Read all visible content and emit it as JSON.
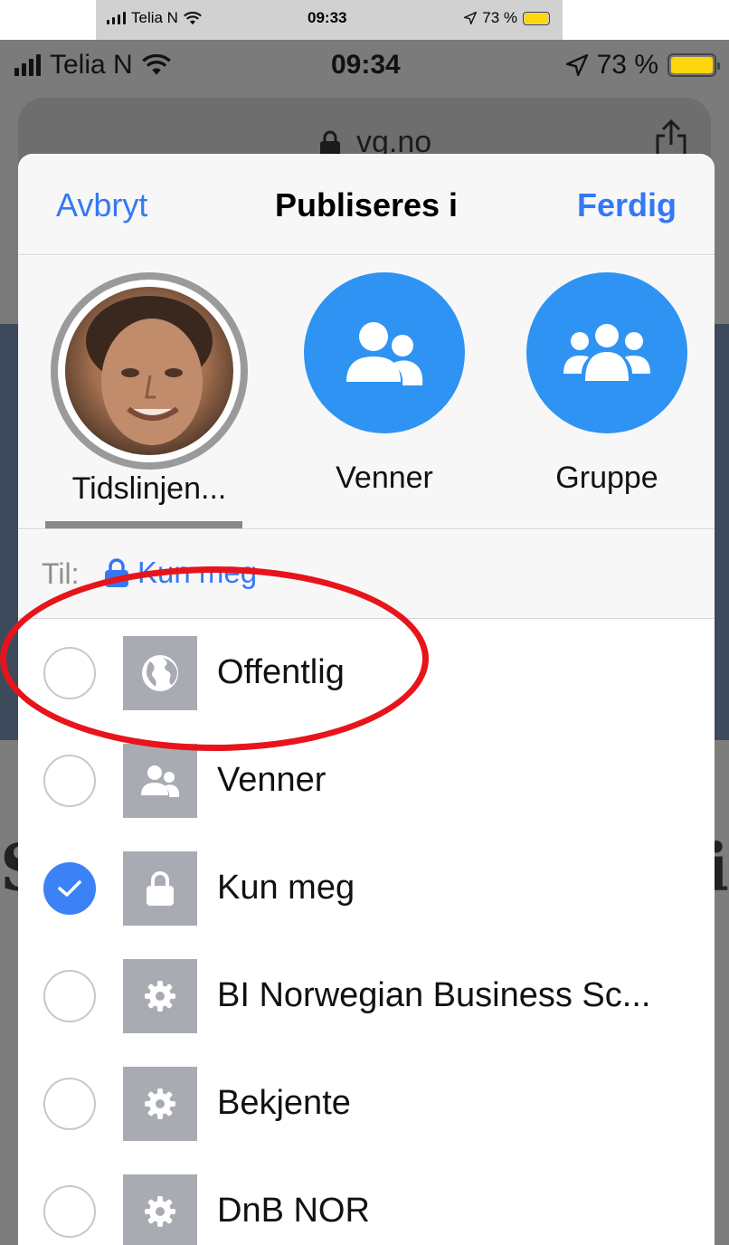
{
  "mini_status": {
    "carrier": "Telia N",
    "time": "09:33",
    "battery": "73 %"
  },
  "status": {
    "carrier": "Telia N",
    "time": "09:34",
    "battery": "73 %"
  },
  "browser": {
    "url": "vg.no"
  },
  "background": {
    "letter_left": "S",
    "letter_right": "i"
  },
  "sheet": {
    "cancel_label": "Avbryt",
    "title": "Publiseres i",
    "done_label": "Ferdig",
    "destinations": [
      {
        "label": "Tidslinjen...",
        "icon": "avatar",
        "selected": true
      },
      {
        "label": "Venner",
        "icon": "friends-icon",
        "selected": false
      },
      {
        "label": "Gruppe",
        "icon": "group-icon",
        "selected": false
      }
    ],
    "to_label": "Til:",
    "to_value": "Kun meg",
    "options": [
      {
        "label": "Offentlig",
        "icon": "globe-icon",
        "checked": false
      },
      {
        "label": "Venner",
        "icon": "friends-icon",
        "checked": false
      },
      {
        "label": "Kun meg",
        "icon": "lock-icon",
        "checked": true
      },
      {
        "label": "BI Norwegian Business Sc...",
        "icon": "gear-icon",
        "checked": false
      },
      {
        "label": "Bekjente",
        "icon": "gear-icon",
        "checked": false
      },
      {
        "label": "DnB NOR",
        "icon": "gear-icon",
        "checked": false
      }
    ]
  },
  "colors": {
    "accent": "#3478f6",
    "circle_blue": "#2f93f3",
    "highlight": "#e8141b",
    "icon_bg": "#a8abb2"
  }
}
